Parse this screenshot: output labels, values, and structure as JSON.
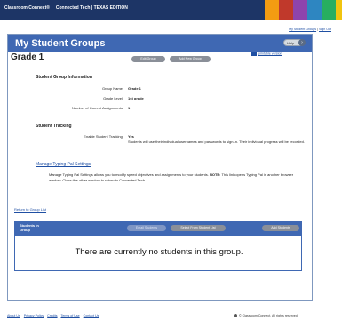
{
  "header": {
    "brand": "Classroom Connect",
    "brand_tm": "®",
    "product": "Connected Tech | TEXAS EDITION",
    "stripe_colors": [
      "#f39c12",
      "#c0392b",
      "#8e44ad",
      "#2e86c1",
      "#27ae60",
      "#f1c40f"
    ]
  },
  "user_bar": {
    "my_student_groups": "My Student Groups",
    "separator": "|",
    "sign_out": "Sign Out"
  },
  "panel": {
    "title": "My Student Groups",
    "help_label": "Help"
  },
  "group": {
    "title": "Grade 1",
    "edit_button": "Edit Group",
    "add_new_button": "Add New Group",
    "printable_version": "printable version"
  },
  "info": {
    "section_title": "Student Group Information",
    "rows": [
      {
        "label": "Group Name:",
        "value": "Grade 1"
      },
      {
        "label": "Grade Level:",
        "value": "1st grade"
      },
      {
        "label": "Number of Current Assignments:",
        "value": "1"
      }
    ]
  },
  "tracking": {
    "section_title": "Student Tracking",
    "label": "Enable Student Tracking:",
    "value": "Yes",
    "description": "Students will use their individual usernames and passwords to sign-in. Their individual progress will be recorded."
  },
  "typing_pal": {
    "link": "Manage Typing Pal Settings",
    "description_a": "Manage Typing Pal Settings allows you to modify speed objectives and assignments to your students.",
    "note_label": "NOTE:",
    "description_b": "This link opens Typing Pal in another browser window. Close this other window to return to Connected Tech."
  },
  "return_link": "Return to Group List",
  "students_table": {
    "header": "Students in Group",
    "buttons": {
      "email": "Email Students",
      "select": "Select From Student List",
      "add": "Add Students"
    },
    "empty_message": "There are currently no students in this group."
  },
  "footer": {
    "links": [
      "About Us",
      "Privacy Policy",
      "Credits",
      "Terms of Use",
      "Contact Us"
    ],
    "copyright": "© Classroom Connect. All rights reserved."
  }
}
